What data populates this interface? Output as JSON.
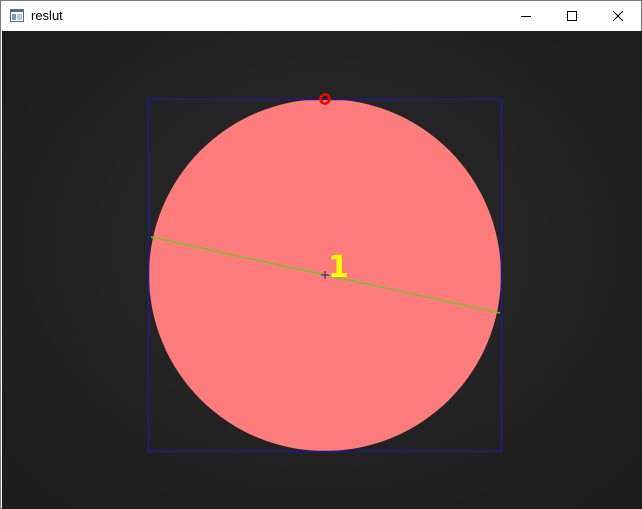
{
  "window": {
    "title": "reslut",
    "icon": "app-window-icon",
    "controls": [
      "minimize-icon",
      "maximize-icon",
      "close-icon"
    ]
  },
  "result": {
    "label": "1",
    "colors": {
      "background": "#222222",
      "circle_fill": "#ff7c7c",
      "bounding_box": "#1c1c8c",
      "orientation_line": "#7bc030",
      "top_marker": "#ff0000",
      "label_text": "#ffff00",
      "center_cross": "#1c1c8c"
    }
  }
}
